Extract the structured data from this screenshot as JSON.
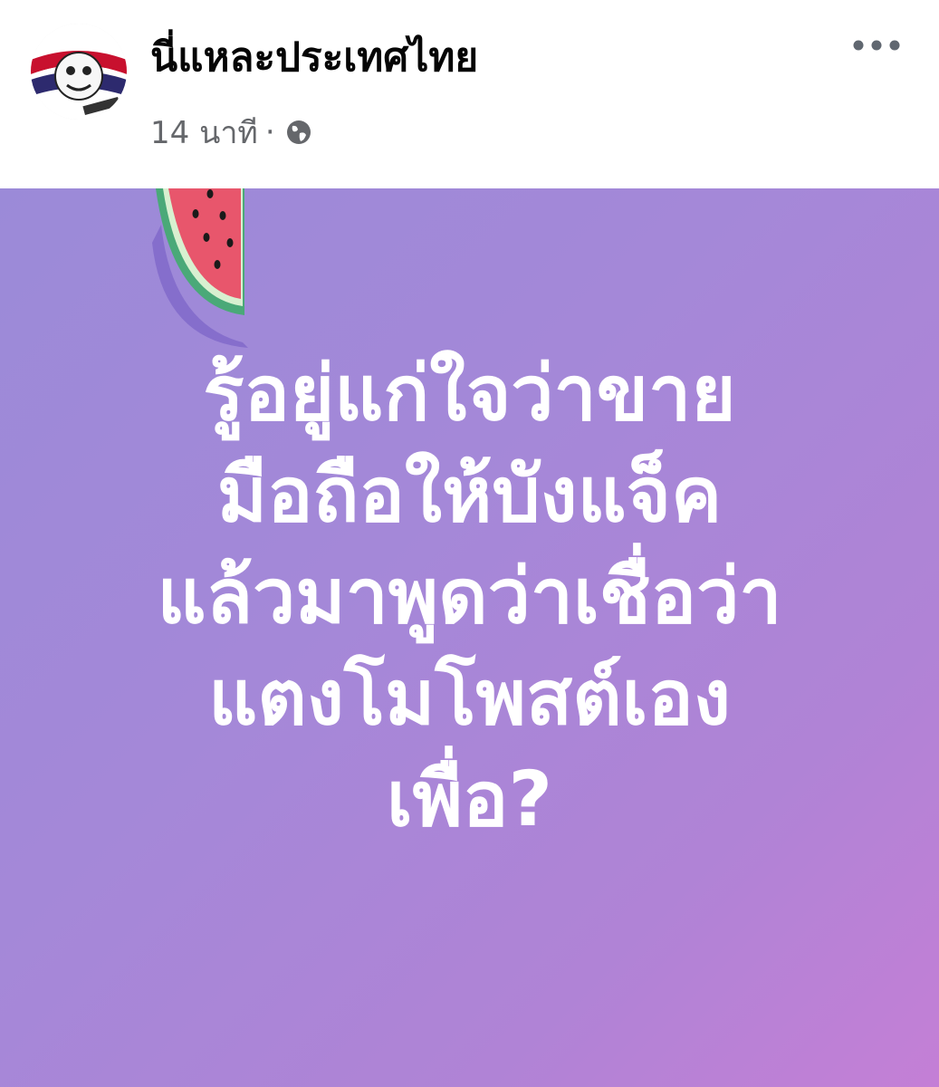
{
  "post": {
    "page_name": "นี่แหละประเทศไทย",
    "timestamp": "14 นาที",
    "separator": "·",
    "privacy_icon": "globe-icon",
    "more_icon": "more-horizontal-icon",
    "avatar_icon": "page-avatar-icon",
    "decoration_icon": "watermelon-slice-icon",
    "text_lines": [
      "รู้อยู่แก่ใจว่าขาย",
      "มือถือให้บังแจ็ค",
      "แล้วมาพูดว่าเชื่อว่า",
      "แตงโมโพสต์เอง",
      "เพื่อ?"
    ]
  },
  "colors": {
    "page_name": "#050505",
    "meta": "#65676b",
    "background_gradient": [
      "#9b8ad8",
      "#c47fd6"
    ],
    "post_text": "#ffffff"
  }
}
